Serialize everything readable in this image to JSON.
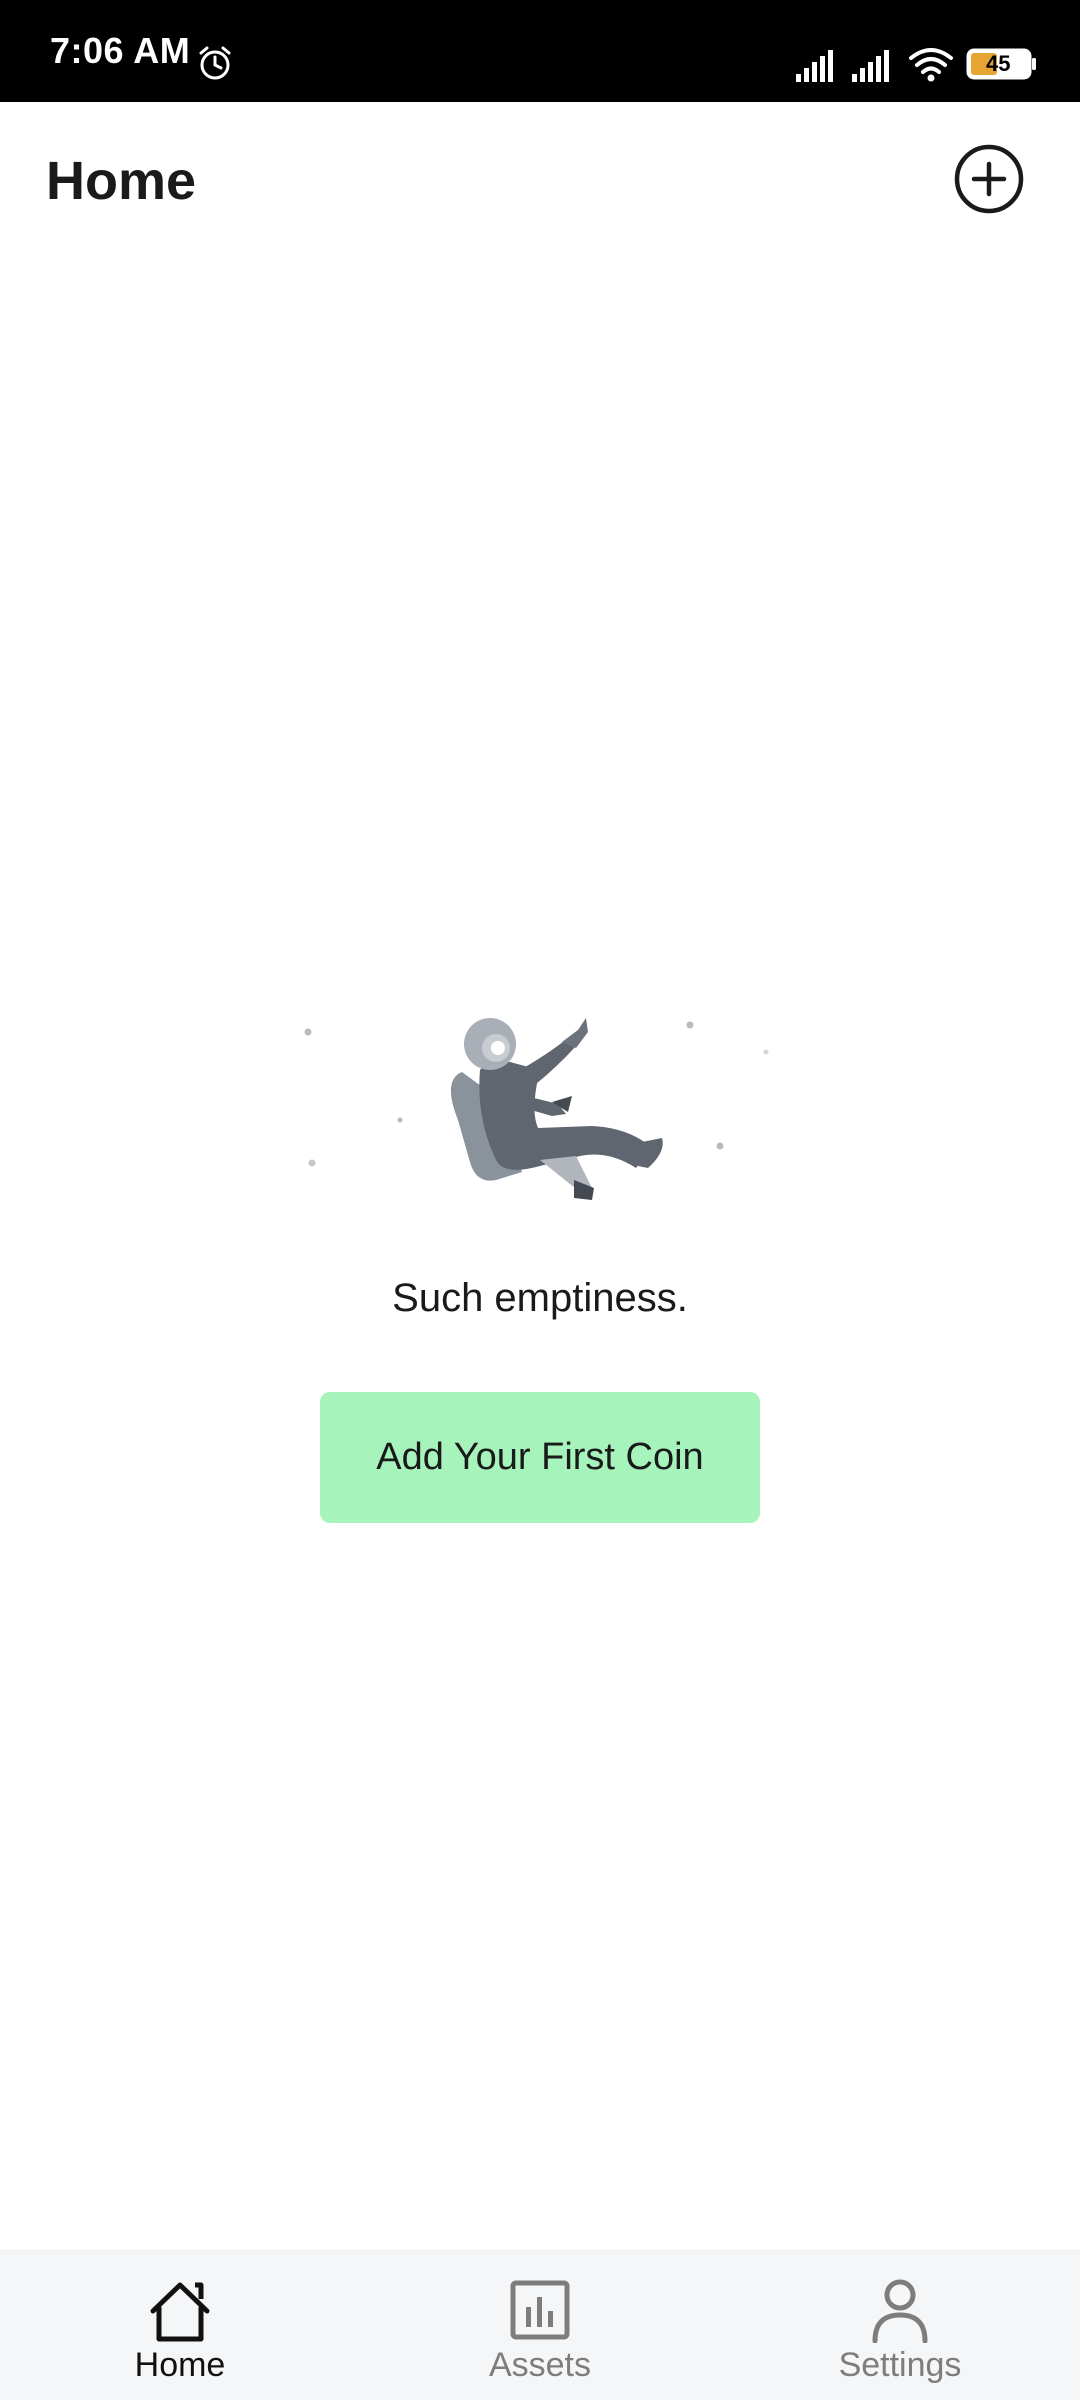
{
  "status_bar": {
    "time": "7:06 AM",
    "battery_level": "45",
    "icons": [
      "alarm-icon",
      "signal-icon",
      "signal-icon",
      "wifi-icon",
      "battery-icon"
    ]
  },
  "header": {
    "title": "Home",
    "add_icon": "plus-circle-icon"
  },
  "empty_state": {
    "illustration": "floating-astronaut",
    "message": "Such emptiness.",
    "button_label": "Add Your First Coin",
    "button_color": "#a6f4bb"
  },
  "bottom_nav": {
    "items": [
      {
        "label": "Home",
        "icon": "home-icon",
        "active": true
      },
      {
        "label": "Assets",
        "icon": "bar-chart-icon",
        "active": false
      },
      {
        "label": "Settings",
        "icon": "person-icon",
        "active": false
      }
    ]
  }
}
